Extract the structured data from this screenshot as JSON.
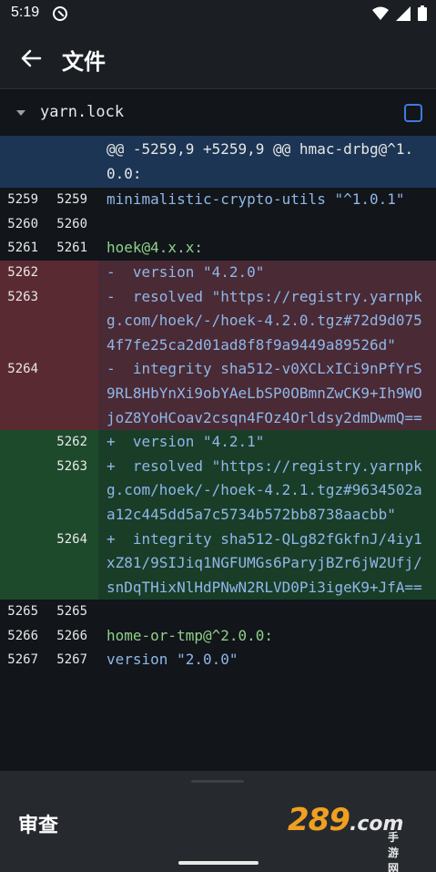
{
  "status": {
    "time": "5:19"
  },
  "appbar": {
    "title": "文件"
  },
  "file": {
    "name": "yarn.lock"
  },
  "diff": {
    "hunk": "@@ -5259,9 +5259,9 @@ hmac-drbg@^1.0.0:",
    "rows": [
      {
        "type": "ctx",
        "old": "5259",
        "new": "5259",
        "text": "minimalistic-crypto-utils \"^1.0.1\"",
        "cls": "dim"
      },
      {
        "type": "ctx",
        "old": "5260",
        "new": "5260",
        "text": "",
        "cls": "dim"
      },
      {
        "type": "ctx",
        "old": "5261",
        "new": "5261",
        "text": "hoek@4.x.x:",
        "cls": "green"
      },
      {
        "type": "del",
        "old": "5262",
        "new": "",
        "text": "-  version \"4.2.0\"",
        "cls": "dim"
      },
      {
        "type": "del",
        "old": "5263",
        "new": "",
        "text": "-  resolved \"https://registry.yarnpkg.com/hoek/-/hoek-4.2.0.tgz#72d9d0754f7fe25ca2d01ad8f8f9a9449a89526d\"",
        "cls": "dim"
      },
      {
        "type": "del",
        "old": "5264",
        "new": "",
        "text": "-  integrity sha512-v0XCLxICi9nPfYrS9RL8HbYnXi9obYAeLbSP0OBmnZwCK9+Ih9WOjoZ8YoHCoav2csqn4FOz4Orldsy2dmDwmQ==",
        "cls": "dim"
      },
      {
        "type": "add",
        "old": "",
        "new": "5262",
        "text": "+  version \"4.2.1\"",
        "cls": "dim"
      },
      {
        "type": "add",
        "old": "",
        "new": "5263",
        "text": "+  resolved \"https://registry.yarnpkg.com/hoek/-/hoek-4.2.1.tgz#9634502aa12c445dd5a7c5734b572bb8738aacbb\"",
        "cls": "dim"
      },
      {
        "type": "add",
        "old": "",
        "new": "5264",
        "text": "+  integrity sha512-QLg82fGkfnJ/4iy1xZ81/9SIJiq1NGFUMGs6ParyjBZr6jW2Ufj/snDqTHixNlHdPNwN2RLVD0Pi3igeK9+JfA==",
        "cls": "dim"
      },
      {
        "type": "ctx",
        "old": "5265",
        "new": "5265",
        "text": "",
        "cls": "dim"
      },
      {
        "type": "ctx",
        "old": "5266",
        "new": "5266",
        "text": "home-or-tmp@^2.0.0:",
        "cls": "green"
      },
      {
        "type": "ctx",
        "old": "5267",
        "new": "5267",
        "text": "version \"2.0.0\"",
        "cls": "dim"
      }
    ]
  },
  "bottom": {
    "review_label": "审查",
    "watermark_num": "289",
    "watermark_com": ".com",
    "watermark_sub": "手游网"
  },
  "colors": {
    "accent": "#3d7be0",
    "deleted": "#4a2a35",
    "added": "#1a3d28",
    "hunk": "#1c3554"
  }
}
